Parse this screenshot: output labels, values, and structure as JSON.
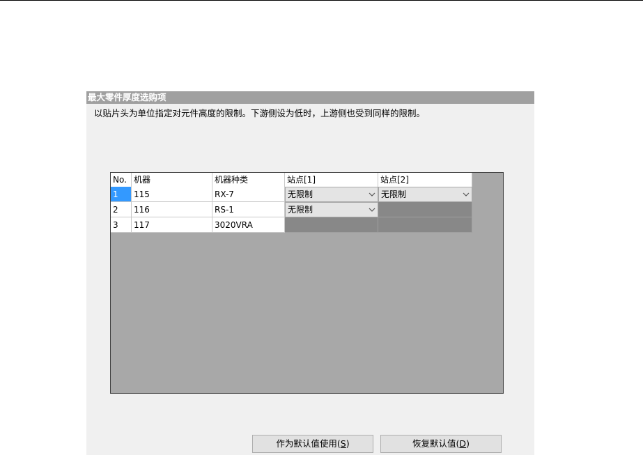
{
  "dialog": {
    "title": "最大零件厚度选购项",
    "description": "以贴片头为单位指定对元件高度的限制。下游侧设为低时，上游侧也受到同样的限制。"
  },
  "table": {
    "headers": {
      "no": "No.",
      "machine": "机器",
      "machine_type": "机器种类",
      "station1": "站点[1]",
      "station2": "站点[2]"
    },
    "rows": [
      {
        "no": "1",
        "machine": "115",
        "machine_type": "RX-7",
        "station1": "无限制",
        "station2": "无限制",
        "selected": true
      },
      {
        "no": "2",
        "machine": "116",
        "machine_type": "RS-1",
        "station1": "无限制",
        "station2": null
      },
      {
        "no": "3",
        "machine": "117",
        "machine_type": "3020VRA",
        "station1": null,
        "station2": null
      }
    ]
  },
  "buttons": {
    "use_as_default": {
      "label": "作为默认值使用(",
      "mnemonic": "S",
      "suffix": ")"
    },
    "restore_default": {
      "label": "恢复默认值(",
      "mnemonic": "D",
      "suffix": ")"
    }
  },
  "colors": {
    "title_bar": "#a0a0a0",
    "dialog_bg": "#f0f0f0",
    "grid_bg": "#a8a8a8",
    "disabled_cell": "#888888",
    "selection": "#3399ff"
  },
  "icons": {
    "dropdown": "chevron-down-icon"
  }
}
